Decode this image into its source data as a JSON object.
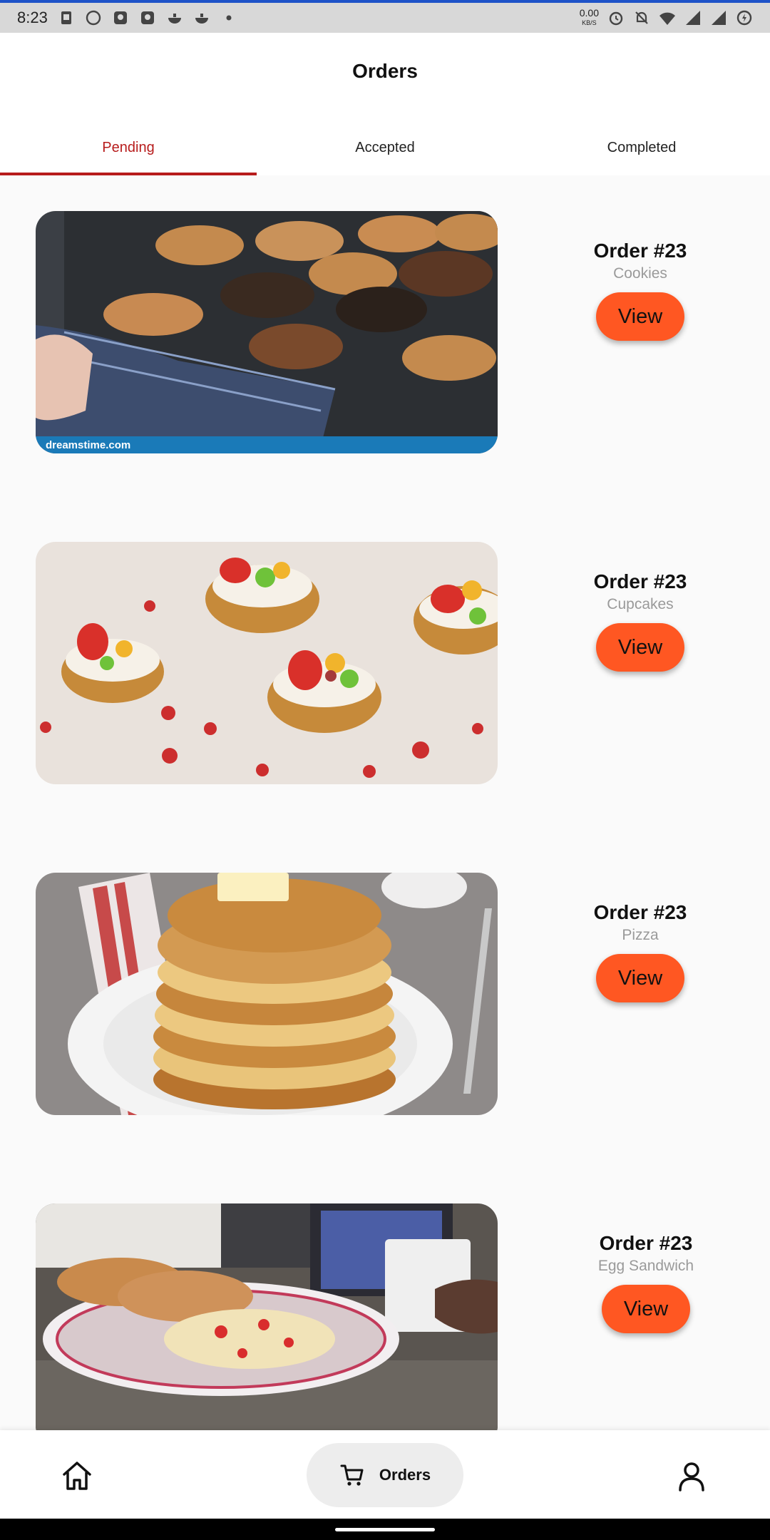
{
  "status_bar": {
    "time": "8:23",
    "speed_value": "0.00",
    "speed_unit": "KB/S"
  },
  "header": {
    "title": "Orders"
  },
  "tabs": [
    {
      "label": "Pending",
      "active": true
    },
    {
      "label": "Accepted",
      "active": false
    },
    {
      "label": "Completed",
      "active": false
    }
  ],
  "orders": [
    {
      "title": "Order #23",
      "item": "Cookies",
      "button": "View",
      "image_watermark": "dreamstime.com"
    },
    {
      "title": "Order #23",
      "item": "Cupcakes",
      "button": "View"
    },
    {
      "title": "Order #23",
      "item": "Pizza",
      "button": "View"
    },
    {
      "title": "Order #23",
      "item": "Egg Sandwich",
      "button": "View"
    }
  ],
  "bottom_nav": {
    "home_icon": "home-icon",
    "orders_label": "Orders",
    "orders_icon": "cart-icon",
    "profile_icon": "user-icon"
  },
  "colors": {
    "accent": "#ff5722",
    "tab_active": "#b71c1c",
    "background": "#fafafa"
  }
}
